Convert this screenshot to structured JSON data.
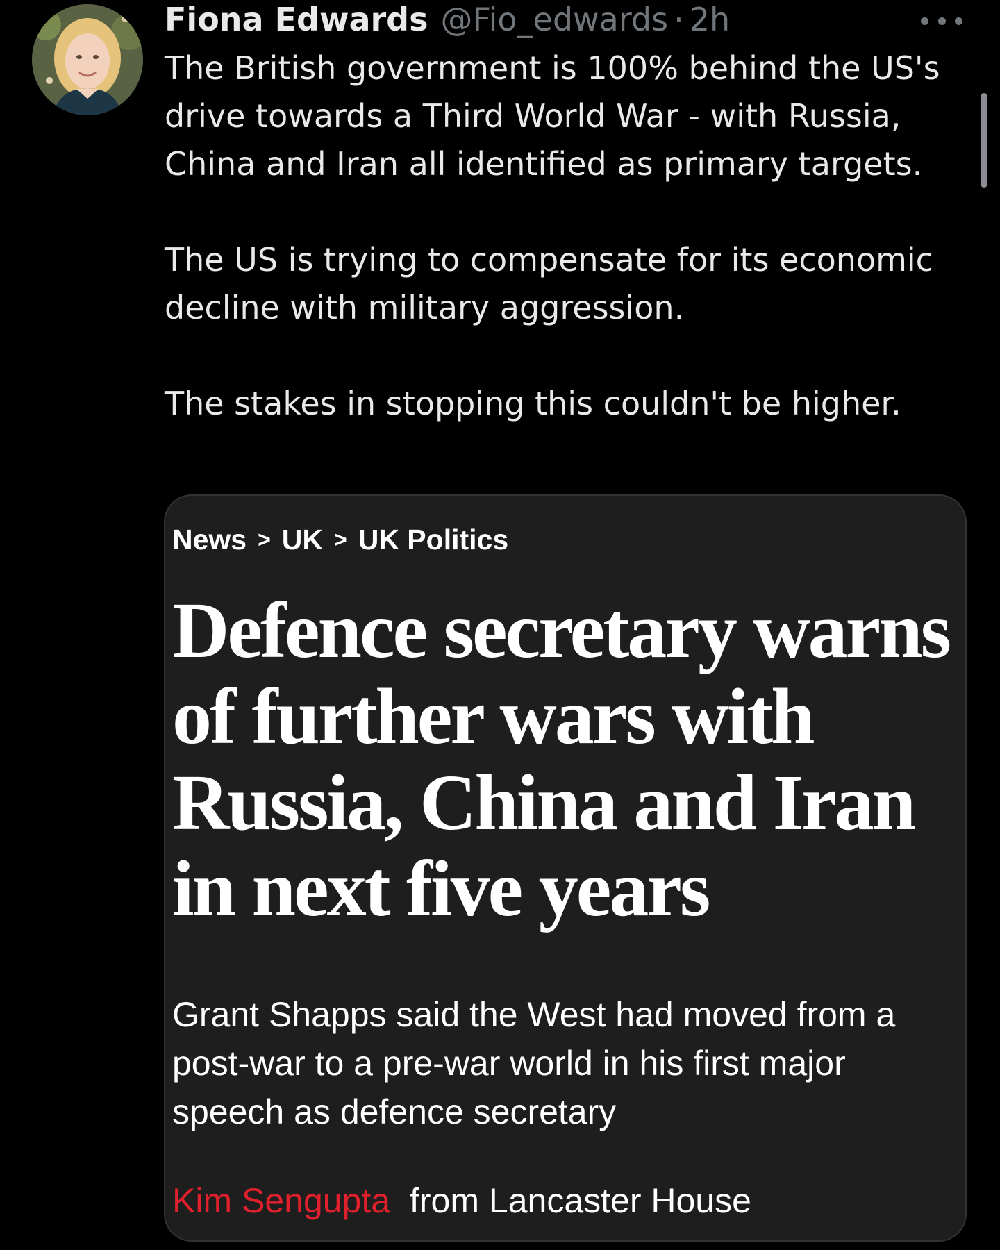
{
  "tweet": {
    "display_name": "Fiona Edwards",
    "handle": "@Fio_edwards",
    "separator": "·",
    "time": "2h",
    "more_icon": "more-horizontal-icon",
    "paragraphs": [
      "The British government is 100% behind the US's drive towards a Third World War - with Russia, China and Iran all identified as primary targets.",
      "The US is trying to compensate for its economic decline with military aggression.",
      "The stakes in stopping this couldn't be higher."
    ]
  },
  "card": {
    "breadcrumb": [
      "News",
      "UK",
      "UK Politics"
    ],
    "breadcrumb_separator": ">",
    "headline": "Defence secretary warns of further wars with Russia, China and Iran in next five years",
    "subheadline": "Grant Shapps said the West had moved from a post-war to a pre-war world in his first major speech as defence secretary",
    "author": "Kim Sengupta",
    "location": "from Lancaster House"
  },
  "colors": {
    "background": "#000000",
    "card_background": "#1e1e1e",
    "primary_text": "#e7e9ea",
    "secondary_text": "#71767b",
    "author_red": "#e0202c"
  }
}
